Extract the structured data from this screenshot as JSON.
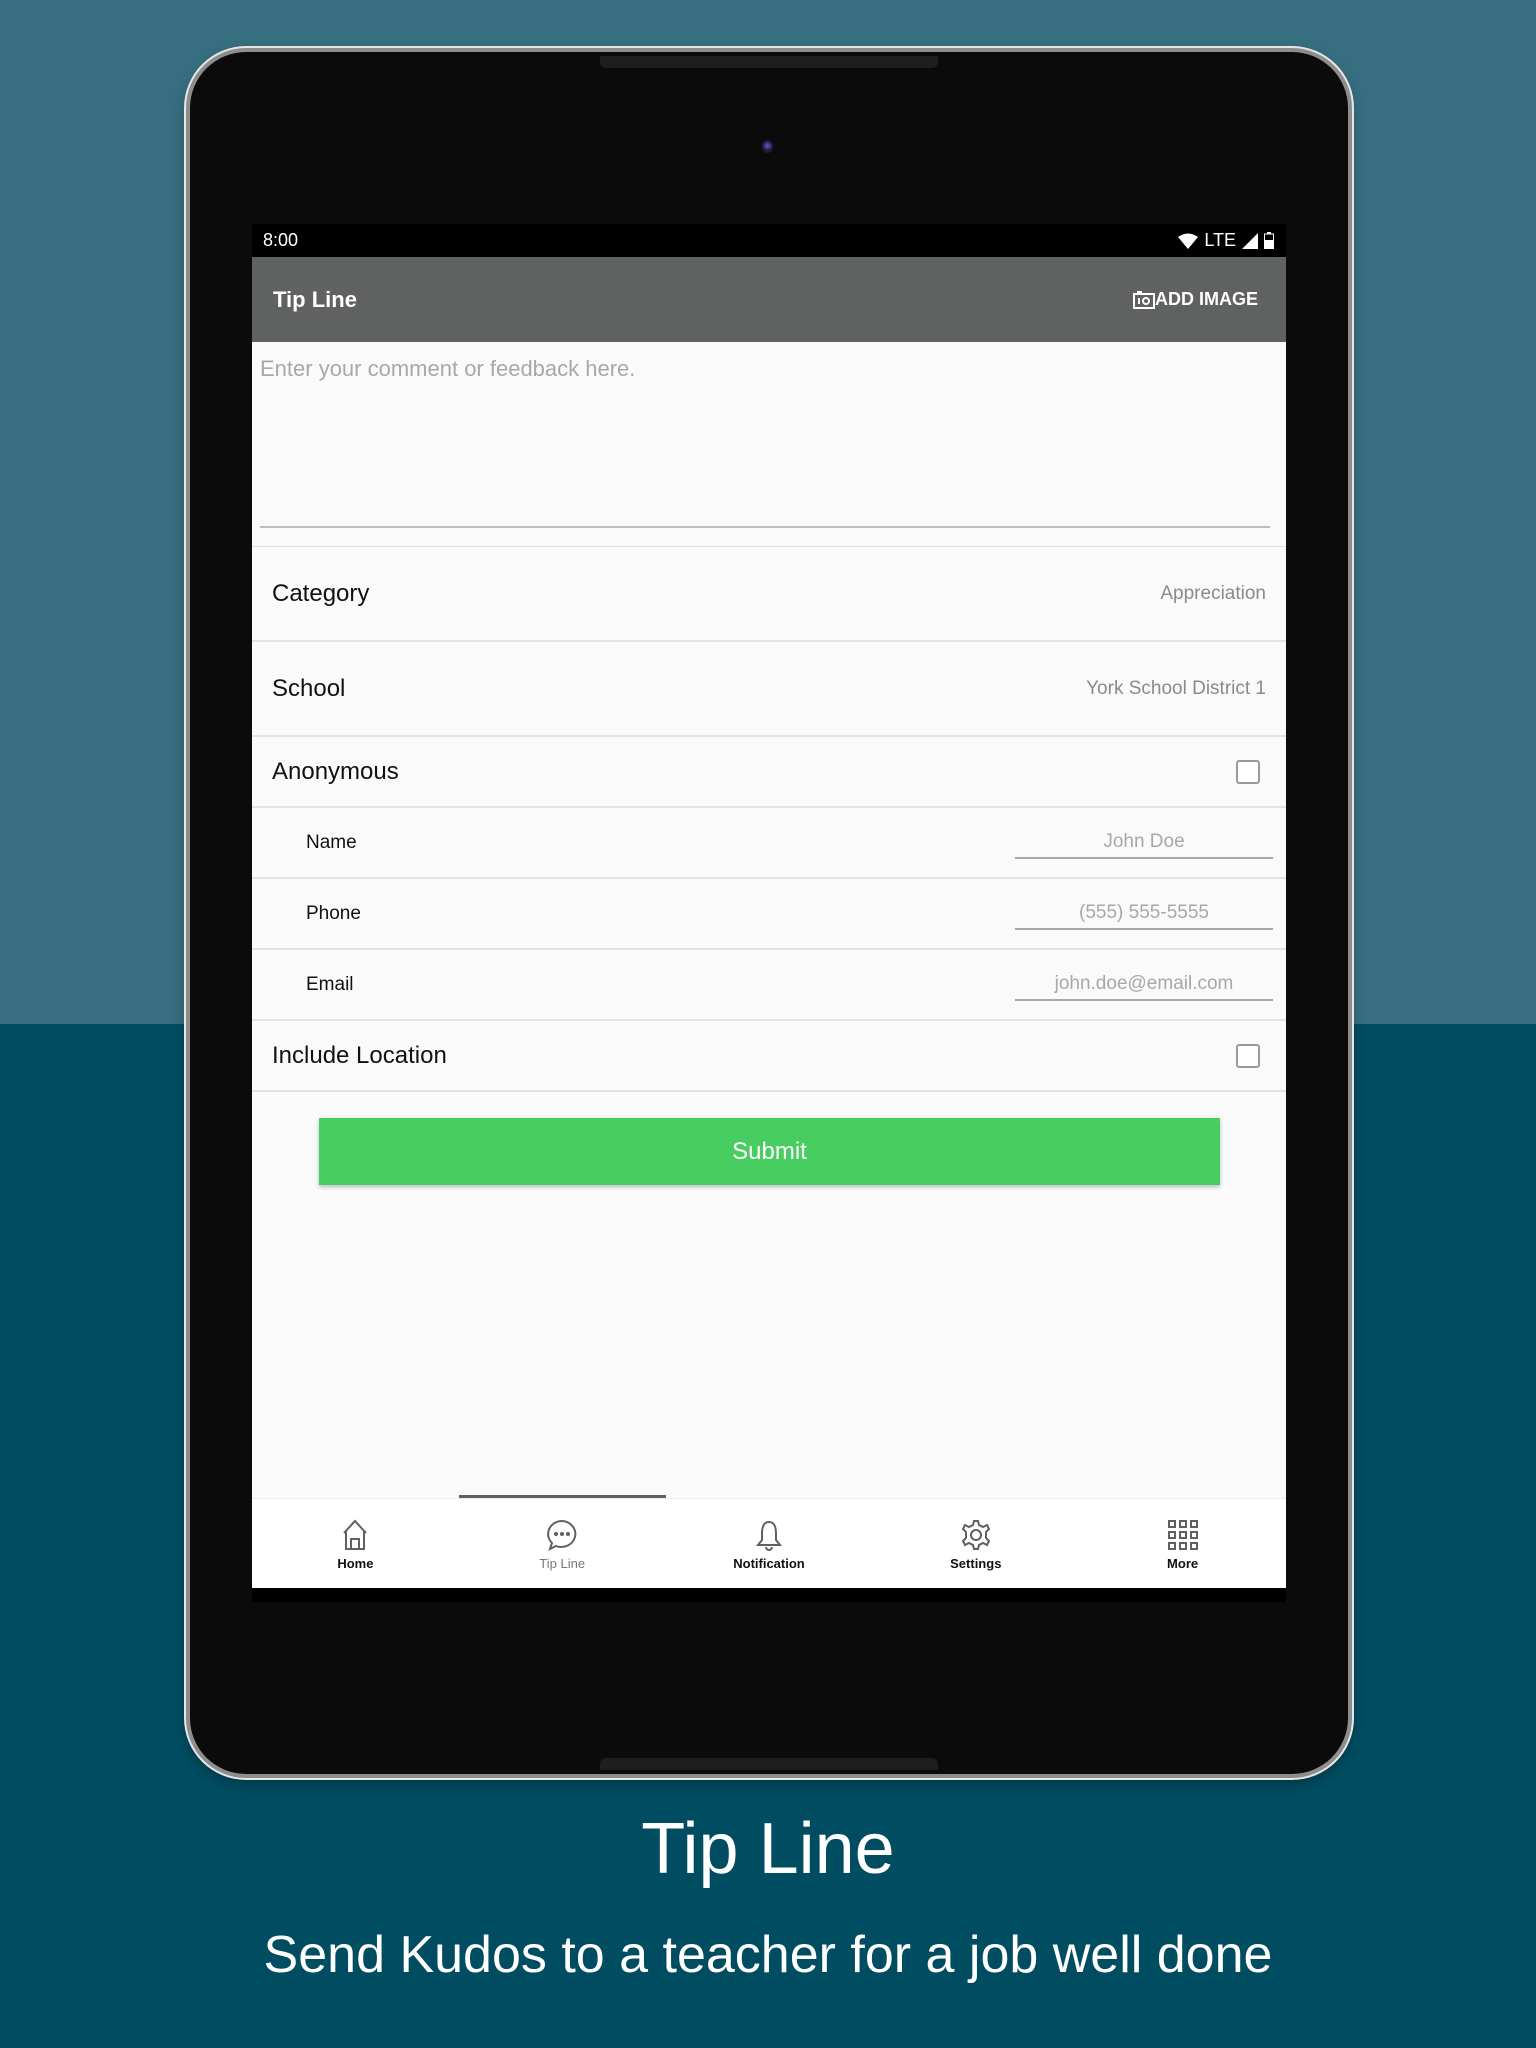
{
  "status_bar": {
    "time": "8:00",
    "network": "LTE"
  },
  "app_bar": {
    "title": "Tip Line",
    "add_image_label": "ADD IMAGE"
  },
  "comment": {
    "placeholder": "Enter your comment or feedback here.",
    "value": ""
  },
  "form": {
    "category": {
      "label": "Category",
      "value": "Appreciation"
    },
    "school": {
      "label": "School",
      "value": "York School District 1"
    },
    "anonymous": {
      "label": "Anonymous",
      "checked": false
    },
    "name": {
      "label": "Name",
      "placeholder": "John Doe"
    },
    "phone": {
      "label": "Phone",
      "placeholder": "(555) 555-5555"
    },
    "email": {
      "label": "Email",
      "placeholder": "john.doe@email.com"
    },
    "include_location": {
      "label": "Include Location",
      "checked": false
    }
  },
  "submit_label": "Submit",
  "tabs": [
    {
      "label": "Home",
      "icon": "home-icon"
    },
    {
      "label": "Tip Line",
      "icon": "chat-bubble-icon",
      "active": true
    },
    {
      "label": "Notification",
      "icon": "bell-icon"
    },
    {
      "label": "Settings",
      "icon": "gear-icon"
    },
    {
      "label": "More",
      "icon": "grid-icon"
    }
  ],
  "caption": {
    "title": "Tip Line",
    "subtitle": "Send Kudos to a teacher for a job well done"
  },
  "colors": {
    "accent": "#48cd60",
    "app_bar": "#606161",
    "bg_top": "#376f80",
    "bg_bottom": "#004d62"
  }
}
